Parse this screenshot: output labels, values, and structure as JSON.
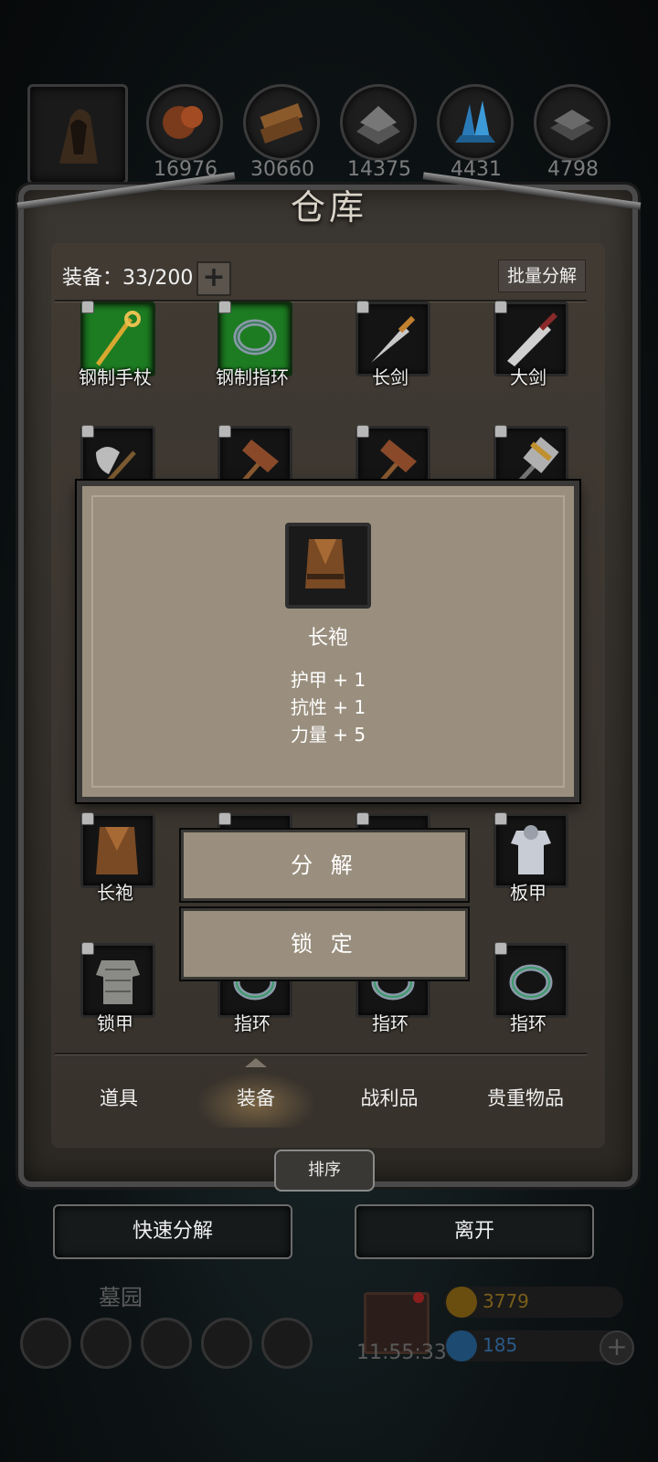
{
  "resources": [
    {
      "value": "16976",
      "icon": "ore-icon"
    },
    {
      "value": "30660",
      "icon": "wood-icon"
    },
    {
      "value": "14375",
      "icon": "stone-icon"
    },
    {
      "value": "4431",
      "icon": "crystal-icon"
    },
    {
      "value": "4798",
      "icon": "iron-icon"
    }
  ],
  "panel": {
    "title": "仓库",
    "equip_count": "装备：33/200",
    "add_label": "+",
    "batch_label": "批量分解"
  },
  "items": [
    {
      "label": "钢制手杖",
      "icon": "staff-icon"
    },
    {
      "label": "钢制指环",
      "icon": "ring-icon"
    },
    {
      "label": "长剑",
      "icon": "longsword-icon"
    },
    {
      "label": "大剑",
      "icon": "greatsword-icon"
    },
    {
      "label": "",
      "icon": "axe-icon"
    },
    {
      "label": "",
      "icon": "hammer-icon"
    },
    {
      "label": "",
      "icon": "hammer-icon"
    },
    {
      "label": "",
      "icon": "mace-icon"
    },
    {
      "label": "长袍",
      "icon": "robe-icon"
    },
    {
      "label": "板甲",
      "icon": "plate-armor-icon"
    },
    {
      "label": "锁甲",
      "icon": "chainmail-icon"
    },
    {
      "label": "指环",
      "icon": "ring-icon"
    },
    {
      "label": "指环",
      "icon": "ring-icon"
    },
    {
      "label": "指环",
      "icon": "ring-icon"
    }
  ],
  "tooltip": {
    "name": "长袍",
    "stats": [
      "护甲 + 1",
      "抗性 + 1",
      "力量 + 5"
    ]
  },
  "menu": {
    "decompose": "分 解",
    "lock": "锁 定"
  },
  "tabs": [
    "道具",
    "装备",
    "战利品",
    "贵重物品"
  ],
  "active_tab": "装备",
  "sort_label": "排序",
  "quick_decompose": "快速分解",
  "leave": "离开",
  "location": "墓园",
  "timer": "11:55:33",
  "gold": "3779",
  "gems": "185",
  "colors": {
    "gold": "#b58a1a",
    "gem": "#2c6fa8",
    "rare": "#1d7c22"
  }
}
